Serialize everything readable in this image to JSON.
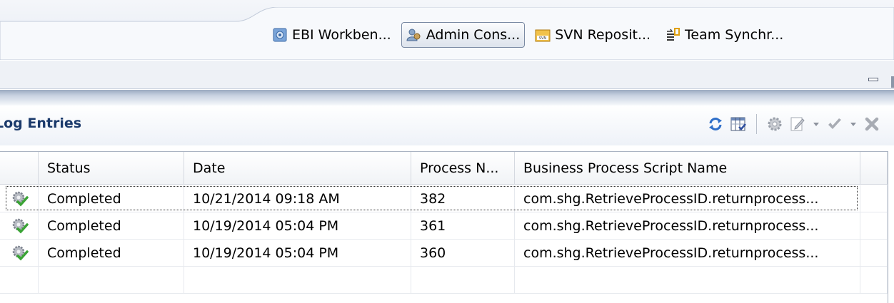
{
  "perspectives": [
    {
      "label": "EBI Workben...",
      "icon": "ebi-workbench-icon",
      "active": false
    },
    {
      "label": "Admin Cons...",
      "icon": "admin-console-icon",
      "active": true
    },
    {
      "label": "SVN Reposit...",
      "icon": "svn-repository-icon",
      "active": false
    },
    {
      "label": "Team Synchr...",
      "icon": "team-synchronize-icon",
      "active": false
    }
  ],
  "view": {
    "title": "Log Entries",
    "tools": [
      "refresh-icon",
      "columns-icon",
      "settings-gear-icon",
      "edit-icon",
      "approve-check-icon",
      "delete-x-icon"
    ]
  },
  "table": {
    "columns": [
      "",
      "Status",
      "Date",
      "Process N...",
      "Business Process Script Name",
      ""
    ],
    "rows": [
      {
        "status": "Completed",
        "date": "10/21/2014 09:18 AM",
        "process": "382",
        "script": "com.shg.RetrieveProcessID.returnprocess..."
      },
      {
        "status": "Completed",
        "date": "10/19/2014 05:04 PM",
        "process": "361",
        "script": "com.shg.RetrieveProcessID.returnprocess..."
      },
      {
        "status": "Completed",
        "date": "10/19/2014 05:04 PM",
        "process": "360",
        "script": "com.shg.RetrieveProcessID.returnprocess..."
      }
    ]
  },
  "colors": {
    "title": "#1b3a6b",
    "check": "#3aa335",
    "refresh": "#2f6fc9",
    "svn": "#e0a010"
  }
}
